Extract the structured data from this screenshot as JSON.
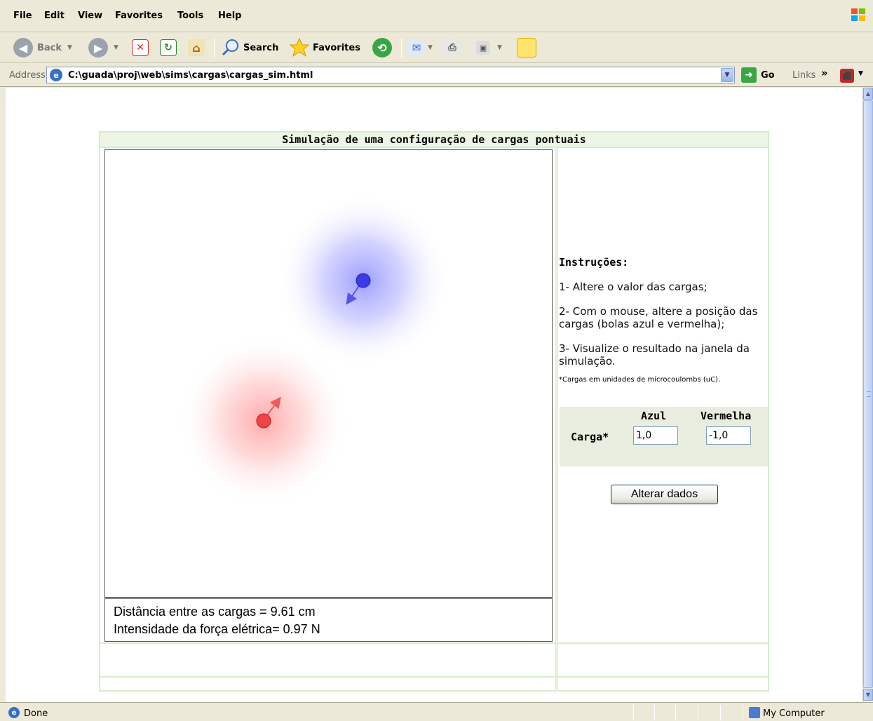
{
  "menu": [
    "File",
    "Edit",
    "View",
    "Favorites",
    "Tools",
    "Help"
  ],
  "toolbar": {
    "back_label": "Back",
    "search_label": "Search",
    "favorites_label": "Favorites"
  },
  "address": {
    "label": "Address",
    "url": "C:\\guada\\proj\\web\\sims\\cargas\\cargas_sim.html",
    "go_label": "Go",
    "links_label": "Links",
    "links_chevron": "»"
  },
  "page": {
    "title": "Simulação de uma configuração de cargas pontuais",
    "readout": {
      "distance": "Distância entre as cargas = 9.61 cm",
      "force": "Intensidade da força elétrica= 0.97 N"
    },
    "instructions": {
      "title": "Instruções:",
      "step1": "1- Altere o valor das cargas;",
      "step2": "2- Com o mouse, altere a posição das cargas (bolas azul e vermelha);",
      "step3": "3- Visualize o resultado na janela da simulação.",
      "note": "*Cargas em unidades de microcoulombs (uC)."
    },
    "form": {
      "header_blue": "Azul",
      "header_red": "Vermelha",
      "row_label": "Carga*",
      "blue_value": "1,0",
      "red_value": "-1,0",
      "submit_label": "Alterar dados"
    }
  },
  "simulation": {
    "charges": [
      {
        "name": "blue",
        "color": "#3b3bea",
        "glow": "#8c8cff",
        "value": 1.0
      },
      {
        "name": "red",
        "color": "#f04444",
        "glow": "#ff9a9a",
        "value": -1.0
      }
    ]
  },
  "status": {
    "text": "Done",
    "zone": "My Computer"
  }
}
